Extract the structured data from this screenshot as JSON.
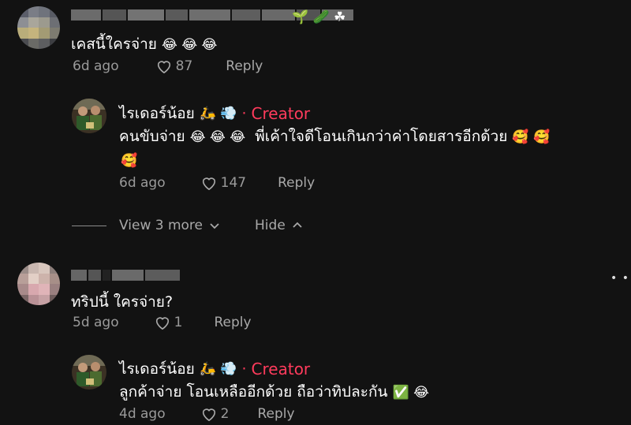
{
  "colors": {
    "background": "#121212",
    "creator_accent": "#ff3b5c",
    "meta_text": "#9a9a9a"
  },
  "comments": [
    {
      "name_emojis": "🌱 🥒 ☘",
      "text": "เคสนี้ใครจ่าย",
      "text_emojis": "😂 😂 😂",
      "time": "6d ago",
      "likes": "87",
      "reply_label": "Reply",
      "reply": {
        "author": "ไรเดอร์น้อย",
        "author_emojis": "🛵 💨",
        "badge_sep": "·",
        "badge": "Creator",
        "line1_a": "คนขับจ่าย",
        "line1_emojis": "😂 😂 😂",
        "line1_b": "พี่เค้าใจดีโอนเกินกว่าค่าโดยสารอีกด้วย",
        "line1_end_emojis": "🥰 🥰",
        "line2_emojis": "🥰",
        "time": "6d ago",
        "likes": "147",
        "reply_label": "Reply"
      },
      "thread_controls": {
        "view_more": "View 3 more",
        "hide": "Hide"
      }
    },
    {
      "text": "ทริปนี้ ใครจ่าย?",
      "time": "5d ago",
      "likes": "1",
      "reply_label": "Reply",
      "reply": {
        "author": "ไรเดอร์น้อย",
        "author_emojis": "🛵 💨",
        "badge_sep": "·",
        "badge": "Creator",
        "line1_a": "ลูกค้าจ่าย โอนเหลืออีกด้วย ถือว่าทิปละกัน",
        "line1_emojis": "✅  😂",
        "time": "4d ago",
        "likes": "2",
        "reply_label": "Reply"
      }
    }
  ],
  "more_icon": "ellipsis-icon"
}
